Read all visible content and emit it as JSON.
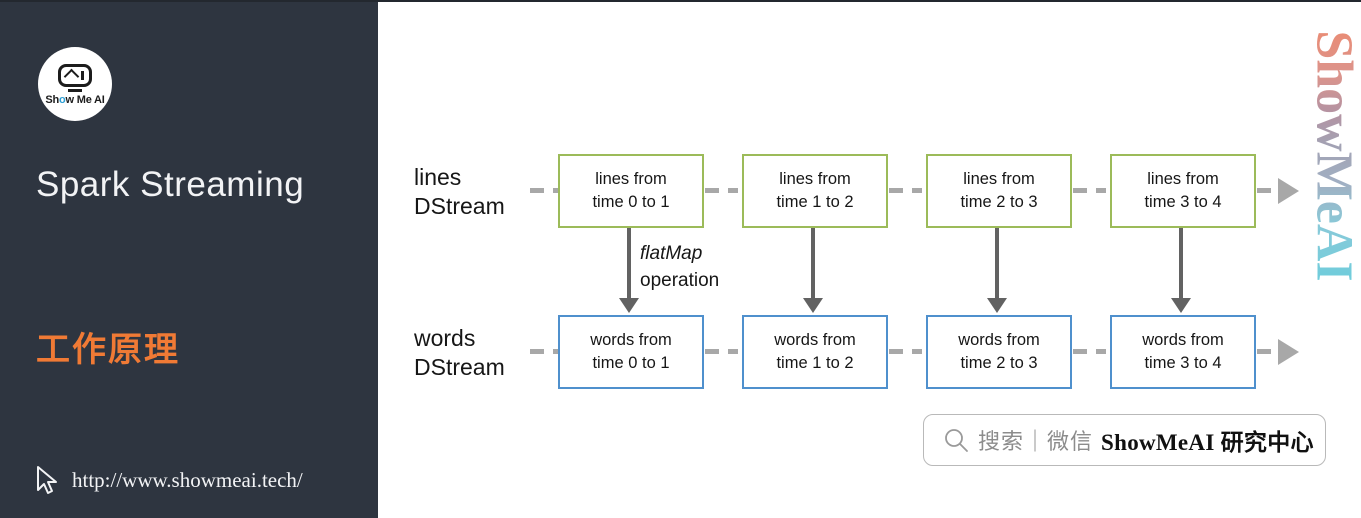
{
  "sidebar": {
    "logo": {
      "icon": "showmeai-robot-logo",
      "wordmark_before": "Sh",
      "wordmark_dot": "o",
      "wordmark_after": "w Me AI"
    },
    "title": "Spark Streaming",
    "subtitle": "工作原理",
    "cursor_icon": "cursor-pointer-icon",
    "url": "http://www.showmeai.tech/",
    "colors": {
      "background": "#2e3540",
      "title": "#f2f3f5",
      "subtitle": "#f07a35"
    }
  },
  "diagram": {
    "type": "flow",
    "row_labels": {
      "lines": [
        "lines",
        "DStream"
      ],
      "words": [
        "words",
        "DStream"
      ]
    },
    "operation": {
      "name": "flatMap",
      "suffix": "operation"
    },
    "rows": [
      {
        "id": "lines-dstream",
        "color": "#9cbb59",
        "nodes": [
          {
            "line1": "lines from",
            "line2": "time 0 to 1"
          },
          {
            "line1": "lines from",
            "line2": "time 1 to 2"
          },
          {
            "line1": "lines from",
            "line2": "time 2 to 3"
          },
          {
            "line1": "lines from",
            "line2": "time 3 to 4"
          }
        ]
      },
      {
        "id": "words-dstream",
        "color": "#4f90cd",
        "nodes": [
          {
            "line1": "words from",
            "line2": "time 0 to 1"
          },
          {
            "line1": "words from",
            "line2": "time 1 to 2"
          },
          {
            "line1": "words from",
            "line2": "time 2 to 3"
          },
          {
            "line1": "words from",
            "line2": "time 3 to 4"
          }
        ]
      }
    ],
    "connector_color": "#a8a8a8",
    "arrow_color": "#626262"
  },
  "watermark": {
    "text": "ShowMeAI",
    "orientation": "vertical"
  },
  "search_pill": {
    "icon": "search-icon",
    "hint": "搜索｜微信",
    "brand": "ShowMeAI 研究中心"
  }
}
